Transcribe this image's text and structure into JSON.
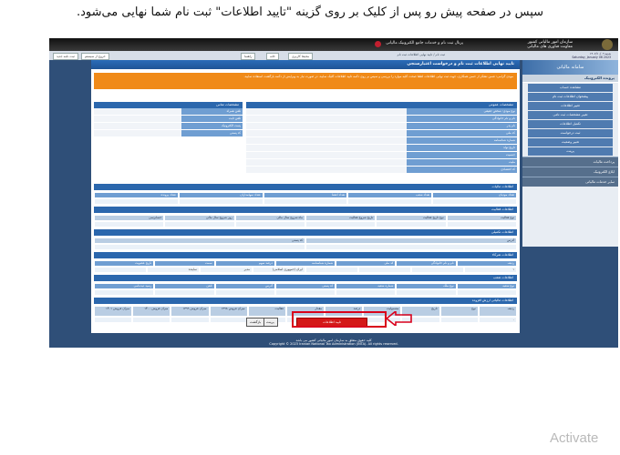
{
  "doc": {
    "caption": "سپس در صفحه پیش رو پس از کلیک بر روی گزینه \"تایید اطلاعات\" ثبت نام شما نهایی می‌شود.",
    "watermark": "Activate"
  },
  "header": {
    "portal_title": "پرتال ثبت نام و خدمات جامع الکترونیک مالیاتی",
    "org_line1": "سازمان امور مالیاتی کشور",
    "org_line2": "معاونت فناوری های مالیاتی"
  },
  "navbar": {
    "tabs": [
      "ثبت نامه جدید",
      "خروج از سیستم",
      "راهنما"
    ],
    "right_tabs": [
      "خانه",
      "محیط کاربری"
    ],
    "breadcrumb": "ثبت نام / تایید نهایی اطلاعات ثبت نام",
    "date_line1": "شنبه ۱۴۰۲/۱۰/۰۹",
    "date_line2": "Saturday, January 06 2023"
  },
  "sidebar": {
    "banner": "سامانه مالیاتی",
    "section_title": "پرونده الکترونیک",
    "items": [
      "مشاهده حساب",
      "پیشخوان اطلاعات ثبت نام",
      "تغییر اطلاعات",
      "تغییر مشخصات ثبت نامی",
      "تکمیل اطلاعات",
      "ثبت درخواست",
      "تغییر وضعیت",
      "پرینت"
    ],
    "footer_items": [
      "پرداخت مالیات",
      "ابلاغ الکترونیک",
      "سایر خدمات مالیاتی"
    ]
  },
  "main": {
    "title": "تایید نهایی اطلاعات ثبت نام و درخواست اعتبارسنجی",
    "warning": "مودی گرامی: ضمن تشکر از حسن همکاری، جهت ثبت نهایی اطلاعات لطفا صحت کلیه موارد را بررسی و سپس بر روی دکمه تایید اطلاعات کلیک نمایید. در صورت نیاز به ویرایش از دکمه بازگشت استفاده نمایید.",
    "general_section": "مشخصات عمومی",
    "general_rows": [
      "نوع مودی: شخص حقیقی",
      "نام و نام خانوادگی",
      "نام پدر",
      "کد ملی",
      "شماره شناسنامه",
      "تاریخ تولد",
      "جنسیت",
      "ملیت",
      "کد اقتصادی"
    ],
    "address_section": "مشخصات تماس",
    "address_rows": [
      "تلفن همراه",
      "تلفن ثابت",
      "پست الکترونیک",
      "کد پستی"
    ],
    "summary_section": "اطلاعات مالیات",
    "summary_headers": [
      "تعداد مودیان",
      "تعداد شعب",
      "تعداد اعضا",
      "تعداد سهامداران",
      "تعداد پرونده"
    ],
    "activity_section": "اطلاعات فعالیت",
    "activity_headers": [
      "نوع فعالیت",
      "نوع تاریخ فعالیت",
      "تاریخ شروع فعالیت",
      "ماه شروع سال مالی",
      "روز شروع سال مالی",
      "حسابرسی"
    ],
    "trust_section": "اطلاعات تکمیلی",
    "trust_headers": [
      "آدرس",
      "کد پستی"
    ],
    "partner_section": "اطلاعات شرکاء",
    "partner_headers": [
      "ردیف",
      "نام و نام خانوادگی",
      "کد ملی",
      "شماره شناسنامه",
      "درصد سهم",
      "سمت",
      "تاریخ عضویت"
    ],
    "partner_row": [
      "۱",
      "",
      "",
      "",
      "ایران (جمهوری اسلامی)",
      "مدیر",
      "نماینده",
      ""
    ],
    "branch_section": "اطلاعات شعب",
    "branch_headers": [
      "نوع شعبه",
      "نوع ملک",
      "شماره شعبه",
      "کد پستی",
      "آدرس",
      "تلفن",
      "رسید ثبت‌نامی"
    ],
    "tax_section": "اطلاعات مالیاتی ارزش افزوده",
    "tax_headers": [
      "ردیف",
      "نوع",
      "تاریخ",
      "مشمولیت",
      "درصد",
      "مقدار",
      "فعالیت",
      "میزان فروش ۱۳۹۸",
      "میزان فروش ۱۳۹۹",
      "میزان فروش ۱۴۰۰",
      "میزان فروش ۱۴۰۱"
    ],
    "tax_row": [
      "۰",
      "",
      "",
      "",
      "",
      "",
      "",
      "",
      "",
      "",
      ""
    ]
  },
  "buttons": {
    "confirm": "تایید اطلاعات",
    "back": "بازگشت",
    "print": "پرینت"
  },
  "footer": {
    "line1": "کلیه حقوق متعلق به سازمان امور مالیاتی کشور می باشد",
    "line2": "Copyright © 2023 Iranian National Tax Administration (INTA). All rights reserved."
  },
  "colors": {
    "highlight": "#d9001b",
    "primary_blue": "#2b67ad",
    "warning_orange": "#f08a18"
  }
}
